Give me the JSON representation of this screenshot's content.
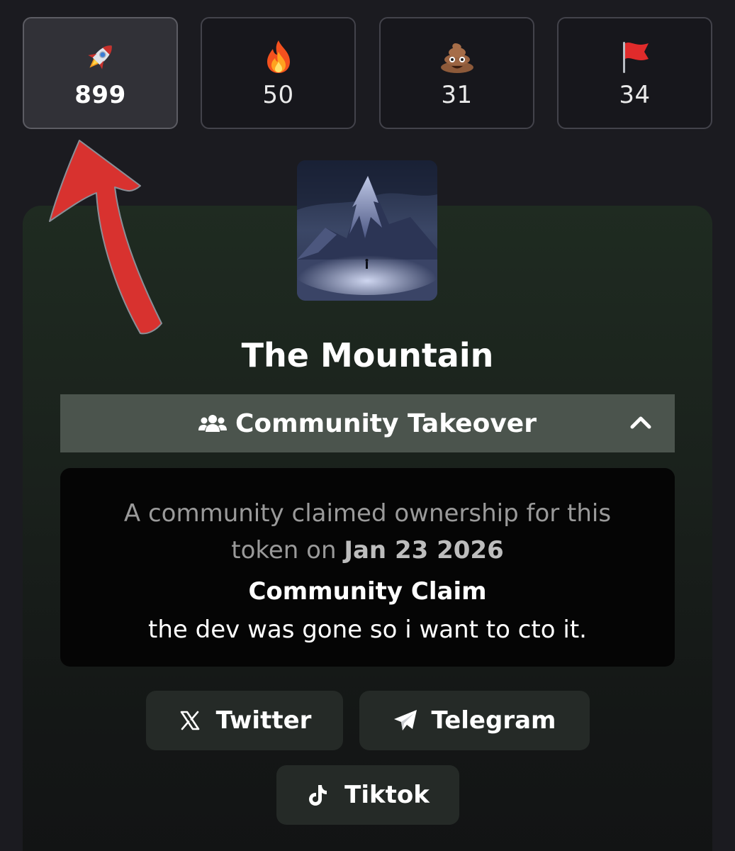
{
  "reactions": [
    {
      "icon": "rocket-icon",
      "count": "899",
      "active": true
    },
    {
      "icon": "fire-icon",
      "count": "50",
      "active": false
    },
    {
      "icon": "poop-icon",
      "count": "31",
      "active": false
    },
    {
      "icon": "red-flag-icon",
      "count": "34",
      "active": false
    }
  ],
  "token": {
    "name": "The Mountain",
    "image": "mountain-avatar"
  },
  "cto": {
    "label": "Community Takeover",
    "icon": "users-icon",
    "toggle_icon": "chevron-up-icon"
  },
  "claim": {
    "line1": "A community claimed ownership for this",
    "line2_prefix": "token on ",
    "date": "Jan 23 2026",
    "heading": "Community Claim",
    "text": "the dev was gone so i want to cto it."
  },
  "socials": [
    {
      "label": "Twitter",
      "icon": "x-icon"
    },
    {
      "label": "Telegram",
      "icon": "telegram-icon"
    },
    {
      "label": "Tiktok",
      "icon": "tiktok-icon"
    }
  ],
  "colors": {
    "background": "#1b1b20",
    "arrow": "#d8322f",
    "cto_bar": "#4b544d",
    "claim_box": "#050505"
  }
}
